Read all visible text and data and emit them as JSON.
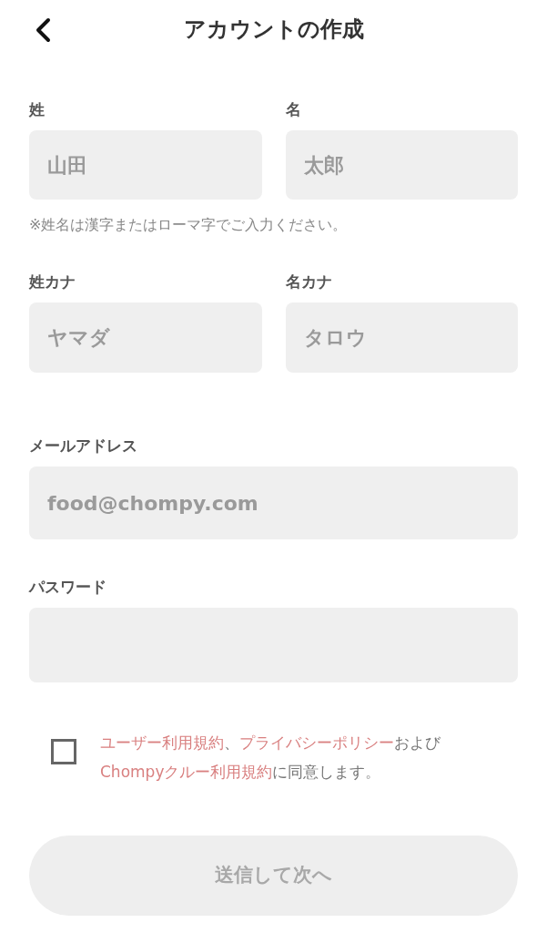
{
  "header": {
    "title": "アカウントの作成"
  },
  "name_fields": [
    {
      "label": "姓",
      "placeholder": "山田"
    },
    {
      "label": "名",
      "placeholder": "太郎"
    }
  ],
  "name_note": "※姓名は漢字またはローマ字でご入力ください。",
  "kana_fields": [
    {
      "label": "姓カナ",
      "placeholder": "ヤマダ"
    },
    {
      "label": "名カナ",
      "placeholder": "タロウ"
    }
  ],
  "email": {
    "label": "メールアドレス",
    "placeholder": "food@chompy.com"
  },
  "password": {
    "label": "パスワード"
  },
  "agreement": {
    "checked": false,
    "segments": [
      {
        "kind": "link",
        "text": "ユーザー利用規約"
      },
      {
        "kind": "text",
        "text": "、"
      },
      {
        "kind": "link",
        "text": "プライバシーポリシー"
      },
      {
        "kind": "text",
        "text": "および"
      },
      {
        "kind": "link",
        "text": "Chompyクルー利用規約"
      },
      {
        "kind": "text",
        "text": "に同意します。"
      }
    ]
  },
  "submit": {
    "label": "送信して次へ",
    "disabled": true
  }
}
